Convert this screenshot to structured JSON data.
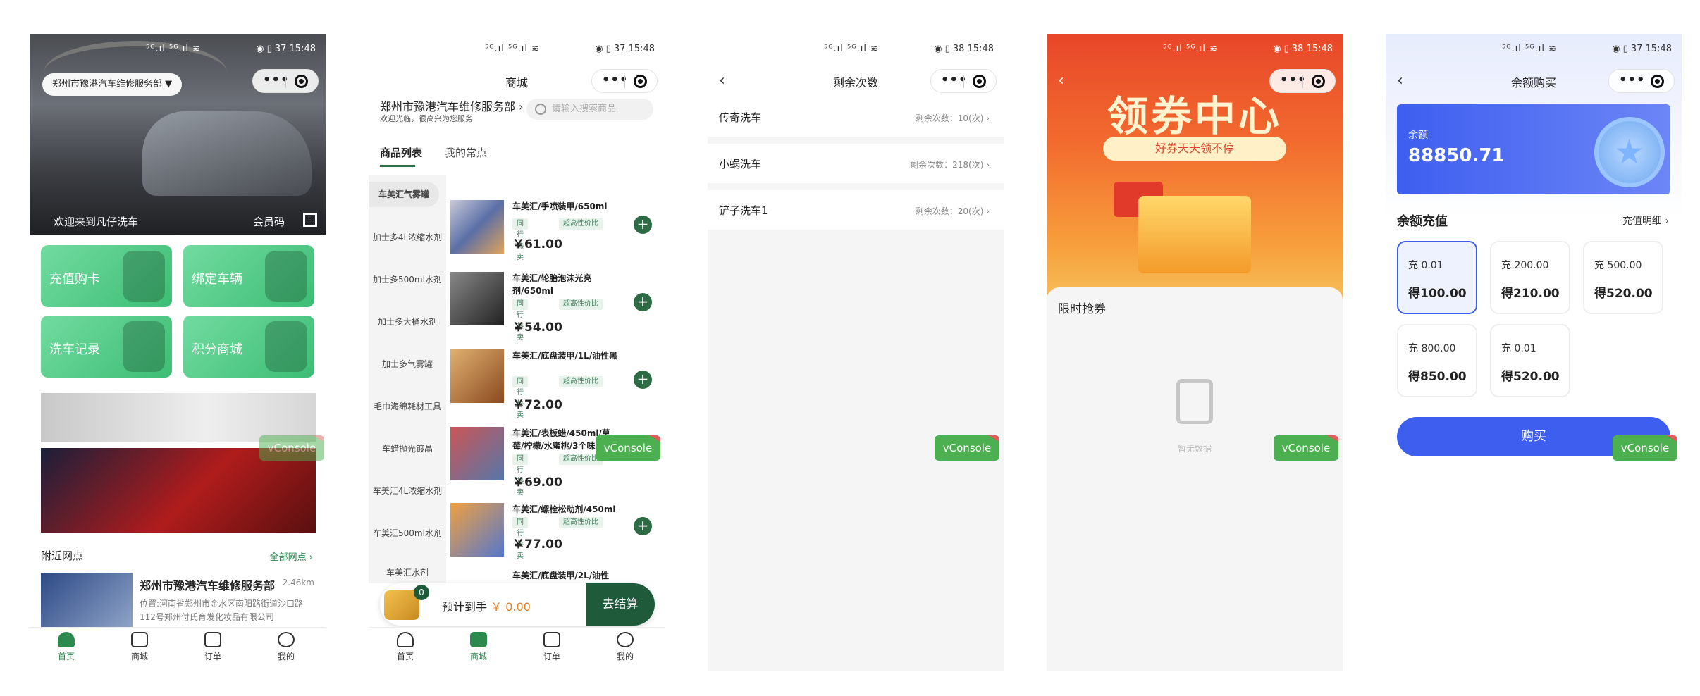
{
  "status": {
    "icons": "⁵ᴳ.ıl ⁵ᴳ.ıl ≋",
    "right1": "◉ ▯ 37 15:48",
    "right2": "◉ ▯ 37 15:48",
    "right3": "◉ ▯ 38 15:48",
    "right4": "◉ ▯ 38 15:48",
    "right5": "◉ ▯ 37 15:48"
  },
  "capsule": {
    "dots": "•••"
  },
  "vconsole": "vConsole",
  "tabs": [
    "首页",
    "商城",
    "订单",
    "我的"
  ],
  "home": {
    "location": "郑州市豫港汽车维修服务部 ▼",
    "welcome": "欢迎来到凡仔洗车",
    "member_code": "会员码",
    "quick": [
      "充值购卡",
      "绑定车辆",
      "洗车记录",
      "积分商城"
    ],
    "nearby_title": "附近网点",
    "all_points": "全部网点 ›",
    "shop_name": "郑州市豫港汽车维修服务部",
    "distance": "2.46km",
    "address": "位置:河南省郑州市金水区南阳路街道沙口路112号郑州付氏育发化妆品有限公司"
  },
  "mall": {
    "title": "商城",
    "store_name": "郑州市豫港汽车维修服务部 ›",
    "store_sub": "欢迎光临，很高兴为您服务",
    "search_placeholder": "请输入搜索商品",
    "tab_list": "商品列表",
    "tab_frequent": "我的常点",
    "categories": [
      "车美汇气雾罐",
      "加士多4L浓缩水剂",
      "加士多500ml水剂",
      "加士多大桶水剂",
      "加士多气雾罐",
      "毛巾海绵耗材工具",
      "车蜡抛光镀晶",
      "车美汇4L浓缩水剂",
      "车美汇500ml水剂",
      "车美汇水剂"
    ],
    "tag1": "同行热卖",
    "tag2": "超高性价比",
    "products": [
      {
        "name": "车美汇/手喷装甲/650ml",
        "price": "￥61.00"
      },
      {
        "name": "车美汇/轮胎泡沫光亮剂/650ml",
        "price": "￥54.00"
      },
      {
        "name": "车美汇/底盘装甲/1L/油性黑",
        "price": "￥72.00"
      },
      {
        "name": "车美汇/表板蜡/450ml/草莓/柠檬/水蜜桃/3个味",
        "price": "￥69.00"
      },
      {
        "name": "车美汇/螺栓松动剂/450ml",
        "price": "￥77.00"
      },
      {
        "name": "车美汇/底盘装甲/2L/油性",
        "price": ""
      }
    ],
    "cart_count": "0",
    "estimate": "预计到手",
    "estimate_value": "￥ 0.00",
    "checkout": "去结算"
  },
  "remaining": {
    "title": "剩余次数",
    "rows": [
      {
        "name": "传奇洗车",
        "count": "剩余次数：10(次) ›"
      },
      {
        "name": "小蜗洗车",
        "count": "剩余次数：218(次) ›"
      },
      {
        "name": "铲子洗车1",
        "count": "剩余次数：20(次) ›"
      }
    ]
  },
  "coupon": {
    "headline": "领券中心",
    "subline": "好券天天领不停",
    "limited": "限时抢券",
    "empty": "暂无数据"
  },
  "balance": {
    "title": "余额购买",
    "balance_label": "余额",
    "balance_value": "88850.71",
    "recharge_title": "余额充值",
    "recharge_detail": "充值明细 ›",
    "options": [
      {
        "charge": "充 0.01",
        "get": "得100.00"
      },
      {
        "charge": "充 200.00",
        "get": "得210.00"
      },
      {
        "charge": "充 500.00",
        "get": "得520.00"
      },
      {
        "charge": "充 800.00",
        "get": "得850.00"
      },
      {
        "charge": "充 0.01",
        "get": "得520.00"
      }
    ],
    "buy": "购买"
  },
  "colors": {
    "brand_green": "#2d8a4e",
    "brand_blue": "#3e5ef0",
    "coupon_red": "#e8472a"
  }
}
